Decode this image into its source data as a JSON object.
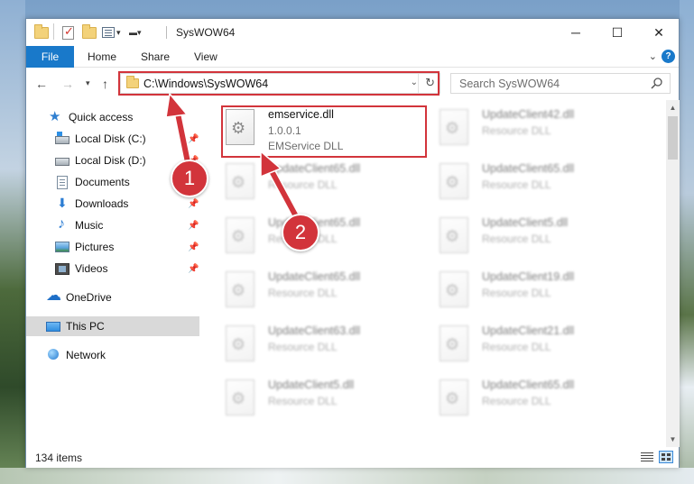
{
  "window": {
    "title": "SysWOW64",
    "controls": {
      "minimize": "─",
      "maximize": "☐",
      "close": "✕"
    }
  },
  "ribbon": {
    "tabs": [
      "File",
      "Home",
      "Share",
      "View"
    ],
    "help": "?"
  },
  "address_bar": {
    "path": "C:\\Windows\\SysWOW64"
  },
  "search": {
    "placeholder": "Search SysWOW64"
  },
  "sidebar": {
    "items": [
      {
        "label": "Quick access",
        "icon": "star-icon"
      },
      {
        "label": "Local Disk (C:)",
        "icon": "drive-icon",
        "pinned": true
      },
      {
        "label": "Local Disk (D:)",
        "icon": "drive-icon",
        "pinned": true
      },
      {
        "label": "Documents",
        "icon": "documents-icon",
        "pinned": true
      },
      {
        "label": "Downloads",
        "icon": "downloads-icon",
        "pinned": true
      },
      {
        "label": "Music",
        "icon": "music-icon",
        "pinned": true
      },
      {
        "label": "Pictures",
        "icon": "pictures-icon",
        "pinned": true
      },
      {
        "label": "Videos",
        "icon": "videos-icon",
        "pinned": true
      },
      {
        "label": "OneDrive",
        "icon": "onedrive-icon"
      },
      {
        "label": "This PC",
        "icon": "this-pc-icon",
        "selected": true
      },
      {
        "label": "Network",
        "icon": "network-icon"
      }
    ]
  },
  "files": {
    "highlighted": {
      "name": "emservice.dll",
      "version": "1.0.0.1",
      "description": "EMService DLL"
    },
    "left_column": [
      {
        "name": "UpdateClient65.dll",
        "description": "Resource DLL"
      },
      {
        "name": "UpdateClient65.dll",
        "description": "Resource DLL"
      },
      {
        "name": "UpdateClient65.dll",
        "description": "Resource DLL"
      },
      {
        "name": "UpdateClient63.dll",
        "description": "Resource DLL"
      },
      {
        "name": "UpdateClient5.dll",
        "description": "Resource DLL"
      }
    ],
    "right_column": [
      {
        "name": "UpdateClient42.dll",
        "description": "Resource DLL"
      },
      {
        "name": "UpdateClient65.dll",
        "description": "Resource DLL"
      },
      {
        "name": "UpdateClient5.dll",
        "description": "Resource DLL"
      },
      {
        "name": "UpdateClient19.dll",
        "description": "Resource DLL"
      },
      {
        "name": "UpdateClient21.dll",
        "description": "Resource DLL"
      },
      {
        "name": "UpdateClient65.dll",
        "description": "Resource DLL"
      }
    ]
  },
  "status_bar": {
    "item_count": "134 items"
  },
  "annotations": {
    "badge_1": "1",
    "badge_2": "2",
    "color": "#d2343b"
  }
}
